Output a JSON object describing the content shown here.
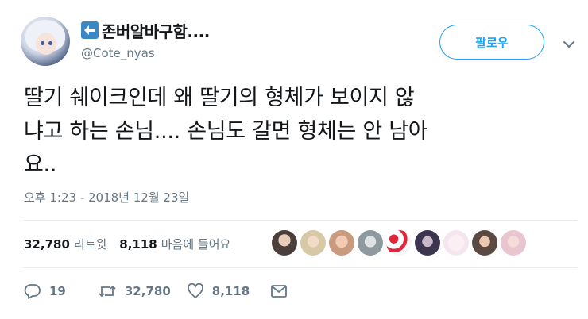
{
  "user": {
    "display_name": "존버알바구함....",
    "handle": "@Cote_nyas",
    "name_prefix_icon": "back-arrow-icon"
  },
  "follow_button": {
    "label": "팔로우"
  },
  "tweet": {
    "text_lines": [
      "딸기 쉐이크인데 왜 딸기의 형체가 보이지 않",
      "냐고 하는 손님.... 손님도 갈면 형체는 안 남아",
      "요.."
    ],
    "timestamp": "오후 1:23 - 2018년 12월 23일"
  },
  "stats": {
    "retweets_count": "32,780",
    "retweets_label": "리트윗",
    "likes_count": "8,118",
    "likes_label": "마음에 들어요"
  },
  "likers": [
    {
      "name": "liker-avatar-1",
      "color": "#4a3f3a"
    },
    {
      "name": "liker-avatar-2",
      "color": "#d8c9a6"
    },
    {
      "name": "liker-avatar-3",
      "color": "#c99a7e"
    },
    {
      "name": "liker-avatar-4",
      "color": "#8f9aa0"
    },
    {
      "name": "liker-avatar-5",
      "color": "#e0263b"
    },
    {
      "name": "liker-avatar-6",
      "color": "#3b3550"
    },
    {
      "name": "liker-avatar-7",
      "color": "#f4e6ee"
    },
    {
      "name": "liker-avatar-8",
      "color": "#5a4a42"
    },
    {
      "name": "liker-avatar-9",
      "color": "#e9c6cf"
    }
  ],
  "actions": {
    "reply_count": "19",
    "retweet_count": "32,780",
    "like_count": "8,118"
  },
  "colors": {
    "accent": "#1da1f2",
    "secondary_text": "#657786",
    "divider": "#e6ecf0"
  }
}
